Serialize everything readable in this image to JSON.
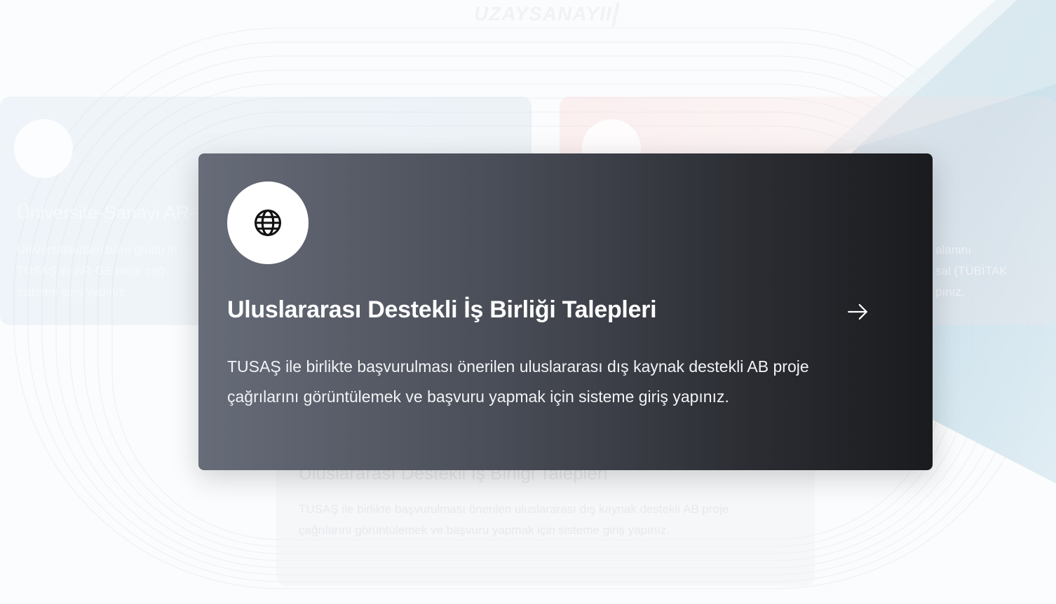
{
  "header": {
    "logo_text": "UZAYSANAYII"
  },
  "background_cards": {
    "left": {
      "title": "Üniversite-Sanayi AR-",
      "body_line_1": "Üniversitelerden bilim grubu ih",
      "body_line_2": "TUSAŞ ile AR-GE proje çağ",
      "body_line_3": "sisteme giriş yapınız."
    },
    "right": {
      "body_line_1": "alanını",
      "body_line_2": "sal (TÜBİTAK",
      "body_line_3": "pınız."
    },
    "bottom": {
      "title": "Uluslararası Destekli İş Birliği Talepleri",
      "description": "TUSAŞ ile birlikte başvurulması önerilen uluslararası dış kaynak destekli AB proje çağrılarını görüntülemek ve başvuru yapmak için sisteme giriş yapınız."
    }
  },
  "card": {
    "icon": "globe-icon",
    "title": "Uluslararası Destekli İş Birliği Talepleri",
    "description": "TUSAŞ ile birlikte başvurulması önerilen uluslararası dış kaynak destekli AB proje çağrılarını görüntülemek ve başvuru yapmak için sisteme giriş yapınız.",
    "arrow_icon": "arrow-right-icon"
  },
  "colors": {
    "card_gradient_start": "#676c79",
    "card_gradient_end": "#1a1b1e",
    "accent_triangle": "#c9dfec"
  }
}
